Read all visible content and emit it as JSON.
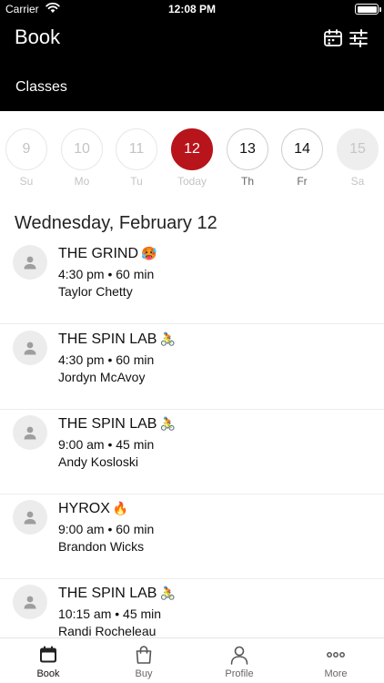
{
  "status_bar": {
    "carrier": "Carrier",
    "time": "12:08 PM"
  },
  "header": {
    "title": "Book",
    "section": "Classes"
  },
  "days": [
    {
      "num": "9",
      "label": "Su",
      "state": "disabled-light"
    },
    {
      "num": "10",
      "label": "Mo",
      "state": "disabled-light"
    },
    {
      "num": "11",
      "label": "Tu",
      "state": "disabled-light"
    },
    {
      "num": "12",
      "label": "Today",
      "state": "selected"
    },
    {
      "num": "13",
      "label": "Th",
      "state": "active"
    },
    {
      "num": "14",
      "label": "Fr",
      "state": "active"
    },
    {
      "num": "15",
      "label": "Sa",
      "state": "disabled"
    }
  ],
  "date_heading": "Wednesday, February 12",
  "classes": [
    {
      "name": "THE GRIND",
      "emoji": "🥵",
      "meta": "4:30 pm • 60 min",
      "instructor": "Taylor Chetty"
    },
    {
      "name": "THE SPIN LAB",
      "emoji": "🚴",
      "meta": "4:30 pm • 60 min",
      "instructor": "Jordyn McAvoy"
    },
    {
      "name": "THE SPIN LAB",
      "emoji": "🚴",
      "meta": "9:00 am • 45 min",
      "instructor": "Andy Kosloski"
    },
    {
      "name": "HYROX",
      "emoji": "🔥",
      "meta": "9:00 am • 60 min",
      "instructor": "Brandon Wicks"
    },
    {
      "name": "THE SPIN LAB",
      "emoji": "🚴",
      "meta": "10:15 am • 45 min",
      "instructor": "Randi Rocheleau"
    }
  ],
  "tabs": [
    {
      "label": "Book",
      "icon": "calendar-icon",
      "active": true
    },
    {
      "label": "Buy",
      "icon": "bag-icon",
      "active": false
    },
    {
      "label": "Profile",
      "icon": "person-icon",
      "active": false
    },
    {
      "label": "More",
      "icon": "ellipsis-icon",
      "active": false
    }
  ],
  "colors": {
    "accent": "#b8141b",
    "header_bg": "#000000"
  }
}
